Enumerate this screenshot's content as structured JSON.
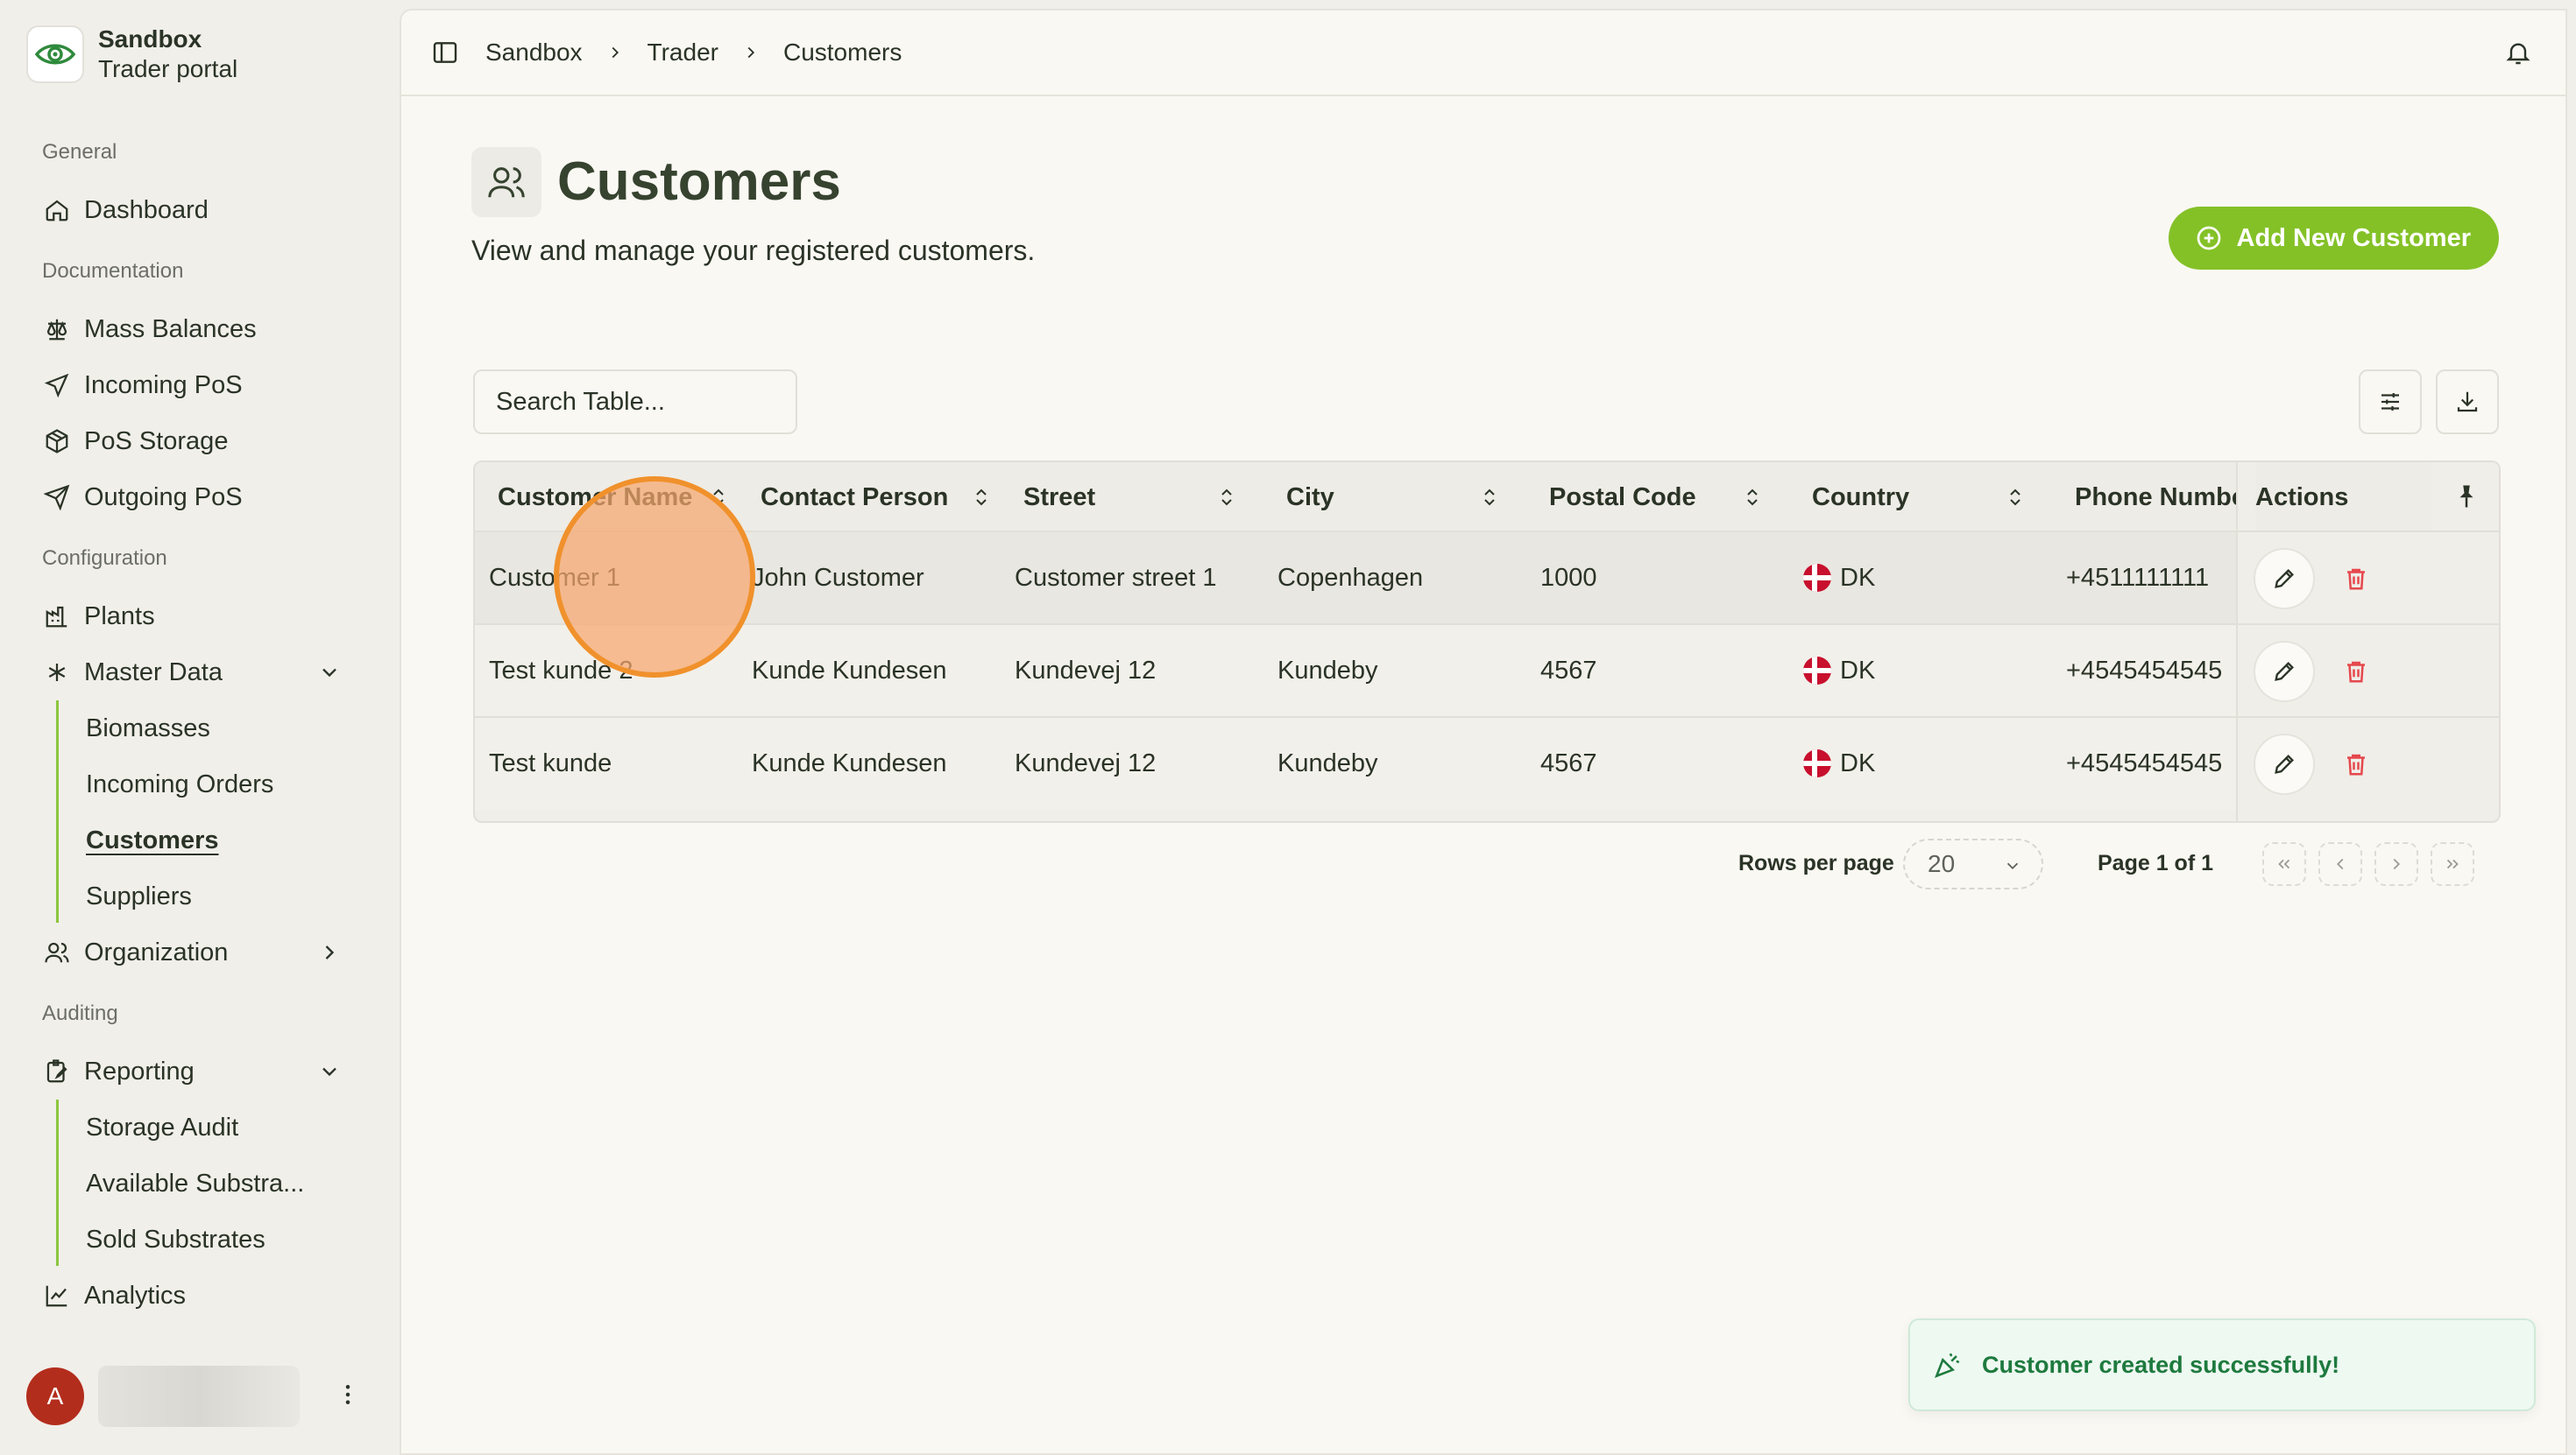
{
  "brand": {
    "name": "Sandbox",
    "subtitle": "Trader portal"
  },
  "sidebar": {
    "groups": {
      "general": "General",
      "documentation": "Documentation",
      "configuration": "Configuration",
      "auditing": "Auditing"
    },
    "items": {
      "dashboard": "Dashboard",
      "mass_balances": "Mass Balances",
      "incoming_pos": "Incoming PoS",
      "pos_storage": "PoS Storage",
      "outgoing_pos": "Outgoing PoS",
      "plants": "Plants",
      "master_data": "Master Data",
      "biomasses": "Biomasses",
      "incoming_orders": "Incoming Orders",
      "customers": "Customers",
      "suppliers": "Suppliers",
      "organization": "Organization",
      "reporting": "Reporting",
      "storage_audit": "Storage Audit",
      "available_substrates": "Available Substra...",
      "sold_substrates": "Sold Substrates",
      "analytics": "Analytics"
    },
    "user_initial": "A"
  },
  "breadcrumb": [
    "Sandbox",
    "Trader",
    "Customers"
  ],
  "page": {
    "title": "Customers",
    "subtitle": "View and manage your registered customers.",
    "add_button": "Add New Customer",
    "search_placeholder": "Search Table..."
  },
  "table": {
    "columns": [
      "Customer Name",
      "Contact Person",
      "Street",
      "City",
      "Postal Code",
      "Country",
      "Phone Numbe",
      "Actions"
    ],
    "rows": [
      {
        "name": "Customer 1",
        "contact": "John Customer",
        "street": "Customer street 1",
        "city": "Copenhagen",
        "postal": "1000",
        "country": "DK",
        "phone": "+4511111111"
      },
      {
        "name": "Test kunde 2",
        "contact": "Kunde Kundesen",
        "street": "Kundevej 12",
        "city": "Kundeby",
        "postal": "4567",
        "country": "DK",
        "phone": "+4545454545"
      },
      {
        "name": "Test kunde",
        "contact": "Kunde Kundesen",
        "street": "Kundevej 12",
        "city": "Kundeby",
        "postal": "4567",
        "country": "DK",
        "phone": "+4545454545"
      }
    ]
  },
  "pagination": {
    "rows_per_page_label": "Rows per page",
    "rows_per_page": "20",
    "page_info": "Page 1 of 1"
  },
  "toast": {
    "message": "Customer created successfully!"
  },
  "colors": {
    "accent": "#84c127",
    "danger": "#e5484d",
    "success": "#1e7a3e",
    "title": "#36432f",
    "click_indicator": "#f0912c"
  }
}
